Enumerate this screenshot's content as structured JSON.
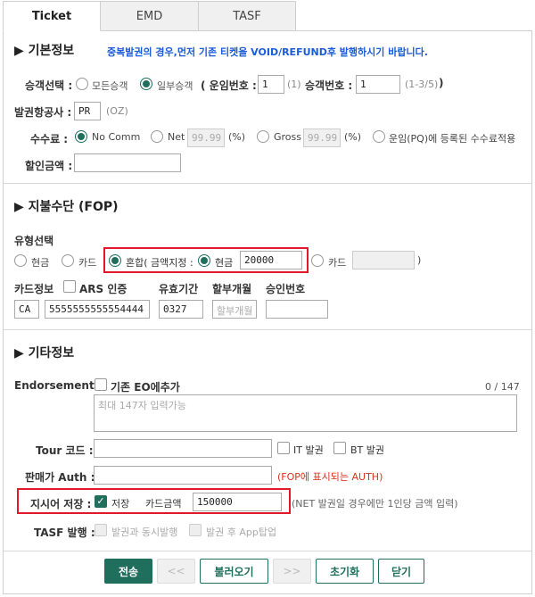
{
  "tabs": [
    "Ticket",
    "EMD",
    "TASF"
  ],
  "basic": {
    "title": "▶ 기본정보",
    "notice": "중복발권의 경우,먼저 기존 티켓을 VOID/REFUND후 발행하시기 바랍니다.",
    "pax_select_label": "승객선택 :",
    "pax_all": "모든승객",
    "pax_partial": "일부승객",
    "fare_no_label": "( 운임번호 :",
    "fare_no_value": "1",
    "fare_no_hint": "(1)",
    "pax_no_label": "승객번호 :",
    "pax_no_value": "1",
    "pax_no_hint": "(1-3/5)",
    "pax_no_close": ")",
    "airline_label": "발권항공사 :",
    "airline_value": "PR",
    "airline_hint": "(OZ)",
    "fee_label": "수수료 :",
    "fee_nocomm": "No Comm",
    "fee_net": "Net",
    "fee_net_value": "99.99",
    "fee_gross": "Gross",
    "fee_gross_value": "99.99",
    "percent": "(%)",
    "fee_pq": "운임(PQ)에 등록된 수수료적용",
    "discount_label": "할인금액 :"
  },
  "fop": {
    "title": "▶ 지불수단 (FOP)",
    "type_label": "유형선택",
    "cash": "현금",
    "card": "카드",
    "mixed": "혼합( 금액지정 :",
    "mixed_cash": "현금",
    "mixed_cash_amount": "20000",
    "mixed_card": "카드",
    "close_paren": ")",
    "card_info_label": "카드정보",
    "ars_label": "ARS 인증",
    "expiry_label": "유효기간",
    "installment_label": "할부개월",
    "approval_label": "승인번호",
    "card_type": "CA",
    "card_number": "5555555555554444",
    "expiry": "0327",
    "installment_placeholder": "할부개월"
  },
  "etc": {
    "title": "▶ 기타정보",
    "endorsement_label": "Endorsement :",
    "eo_add": "기존 EO에추가",
    "counter": "0 / 147",
    "endorsement_placeholder": "최대 147자 입력가능",
    "tour_label": "Tour 코드 :",
    "it_label": "IT 발권",
    "bt_label": "BT 발권",
    "seller_auth_label": "판매가 Auth :",
    "seller_auth_hint": "(FOP에 표시되는 AUTH)",
    "instruction_label": "지시어 저장 :",
    "save_label": "저장",
    "card_amount_label": "카드금액",
    "card_amount_value": "150000",
    "card_amount_hint": "(NET 발권일 경우에만 1인당 금액 입력)",
    "tasf_label": "TASF 발행 :",
    "tasf_simul": "발권과 동시발행",
    "tasf_after": "발권 후 App탑업"
  },
  "buttons": {
    "send": "전송",
    "prev": "<<",
    "load": "불러오기",
    "next": ">>",
    "reset": "초기화",
    "close": "닫기"
  },
  "colors": {
    "accent": "#1f6f5c",
    "notice": "#1a5bd8",
    "highlight": "#e0182a",
    "hint_red": "#d9331f"
  }
}
